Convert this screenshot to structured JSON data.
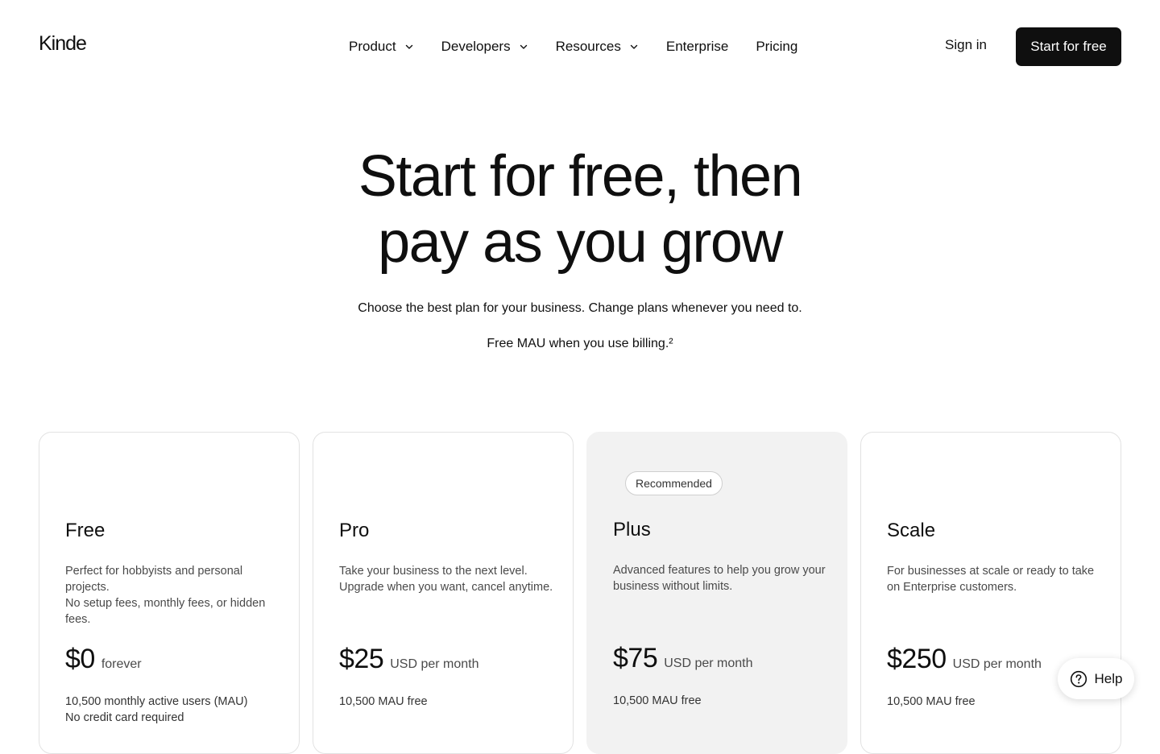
{
  "header": {
    "logo": "Kinde",
    "nav": [
      {
        "label": "Product",
        "has_dropdown": true
      },
      {
        "label": "Developers",
        "has_dropdown": true
      },
      {
        "label": "Resources",
        "has_dropdown": true
      },
      {
        "label": "Enterprise",
        "has_dropdown": false
      },
      {
        "label": "Pricing",
        "has_dropdown": false
      }
    ],
    "sign_in": "Sign in",
    "cta": "Start for free"
  },
  "hero": {
    "title_line1": "Start for free, then",
    "title_line2": "pay as you grow",
    "subtitle": "Choose the best plan for your business. Change plans whenever you need to.",
    "billing_note": "Free MAU when you use billing.²"
  },
  "plans": [
    {
      "name": "Free",
      "badge": "",
      "desc_lines": [
        "Perfect for hobbyists and personal projects.",
        "No setup fees, monthly fees, or hidden fees."
      ],
      "price": "$0",
      "price_unit": "forever",
      "meta_lines": [
        "10,500 monthly active users (MAU)",
        "No credit card required"
      ]
    },
    {
      "name": "Pro",
      "badge": "",
      "desc_lines": [
        "Take your business to the next level. Upgrade when you want, cancel anytime."
      ],
      "price": "$25",
      "price_unit": "USD per month",
      "meta_lines": [
        "10,500 MAU free"
      ]
    },
    {
      "name": "Plus",
      "badge": "Recommended",
      "desc_lines": [
        "Advanced features to help you grow your business without limits."
      ],
      "price": "$75",
      "price_unit": "USD per month",
      "meta_lines": [
        "10,500 MAU free"
      ]
    },
    {
      "name": "Scale",
      "badge": "",
      "desc_lines": [
        "For businesses at scale or ready to take on Enterprise customers."
      ],
      "price": "$250",
      "price_unit": "USD per month",
      "meta_lines": [
        "10,500 MAU free"
      ]
    }
  ],
  "help_widget": {
    "label": "Help",
    "icon": "question-circle-icon"
  },
  "colors": {
    "text": "#0f0f0f",
    "cta_bg": "#0f0f0f",
    "recommended_card_bg": "#f2f2f2",
    "muted_text": "#4a4a4a"
  }
}
